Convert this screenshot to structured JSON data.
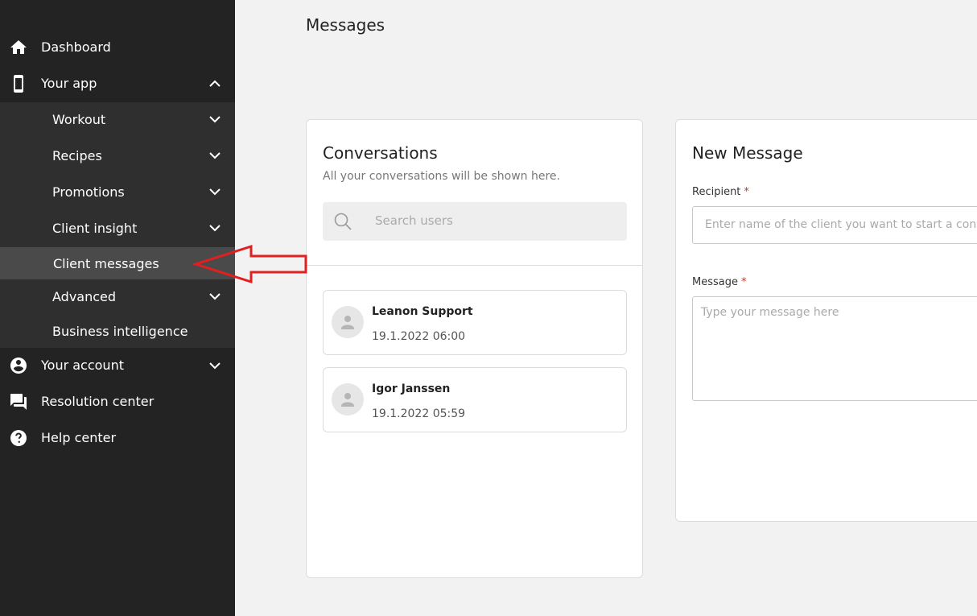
{
  "sidebar": {
    "dashboard": "Dashboard",
    "your_app": "Your app",
    "submenu": {
      "workout": "Workout",
      "recipes": "Recipes",
      "promotions": "Promotions",
      "client_insight": "Client insight",
      "client_messages": "Client messages",
      "advanced": "Advanced",
      "business_intelligence": "Business intelligence"
    },
    "your_account": "Your account",
    "resolution_center": "Resolution center",
    "help_center": "Help center"
  },
  "page": {
    "title": "Messages"
  },
  "conversations": {
    "title": "Conversations",
    "subtitle": "All your conversations will be shown here.",
    "search_placeholder": "Search users",
    "items": [
      {
        "name": "Leanon Support",
        "time": "19.1.2022 06:00"
      },
      {
        "name": "Igor Janssen",
        "time": "19.1.2022 05:59"
      }
    ]
  },
  "new_message": {
    "title": "New Message",
    "recipient_label": "Recipient",
    "recipient_placeholder": "Enter name of the client you want to start a conversation with",
    "message_label": "Message",
    "message_placeholder": "Type your message here",
    "required_mark": "*"
  },
  "colors": {
    "sidebar_bg": "#232323",
    "submenu_bg": "#2f2f2f",
    "active_bg": "#4a4a4a",
    "annotation_arrow": "#e02020"
  }
}
